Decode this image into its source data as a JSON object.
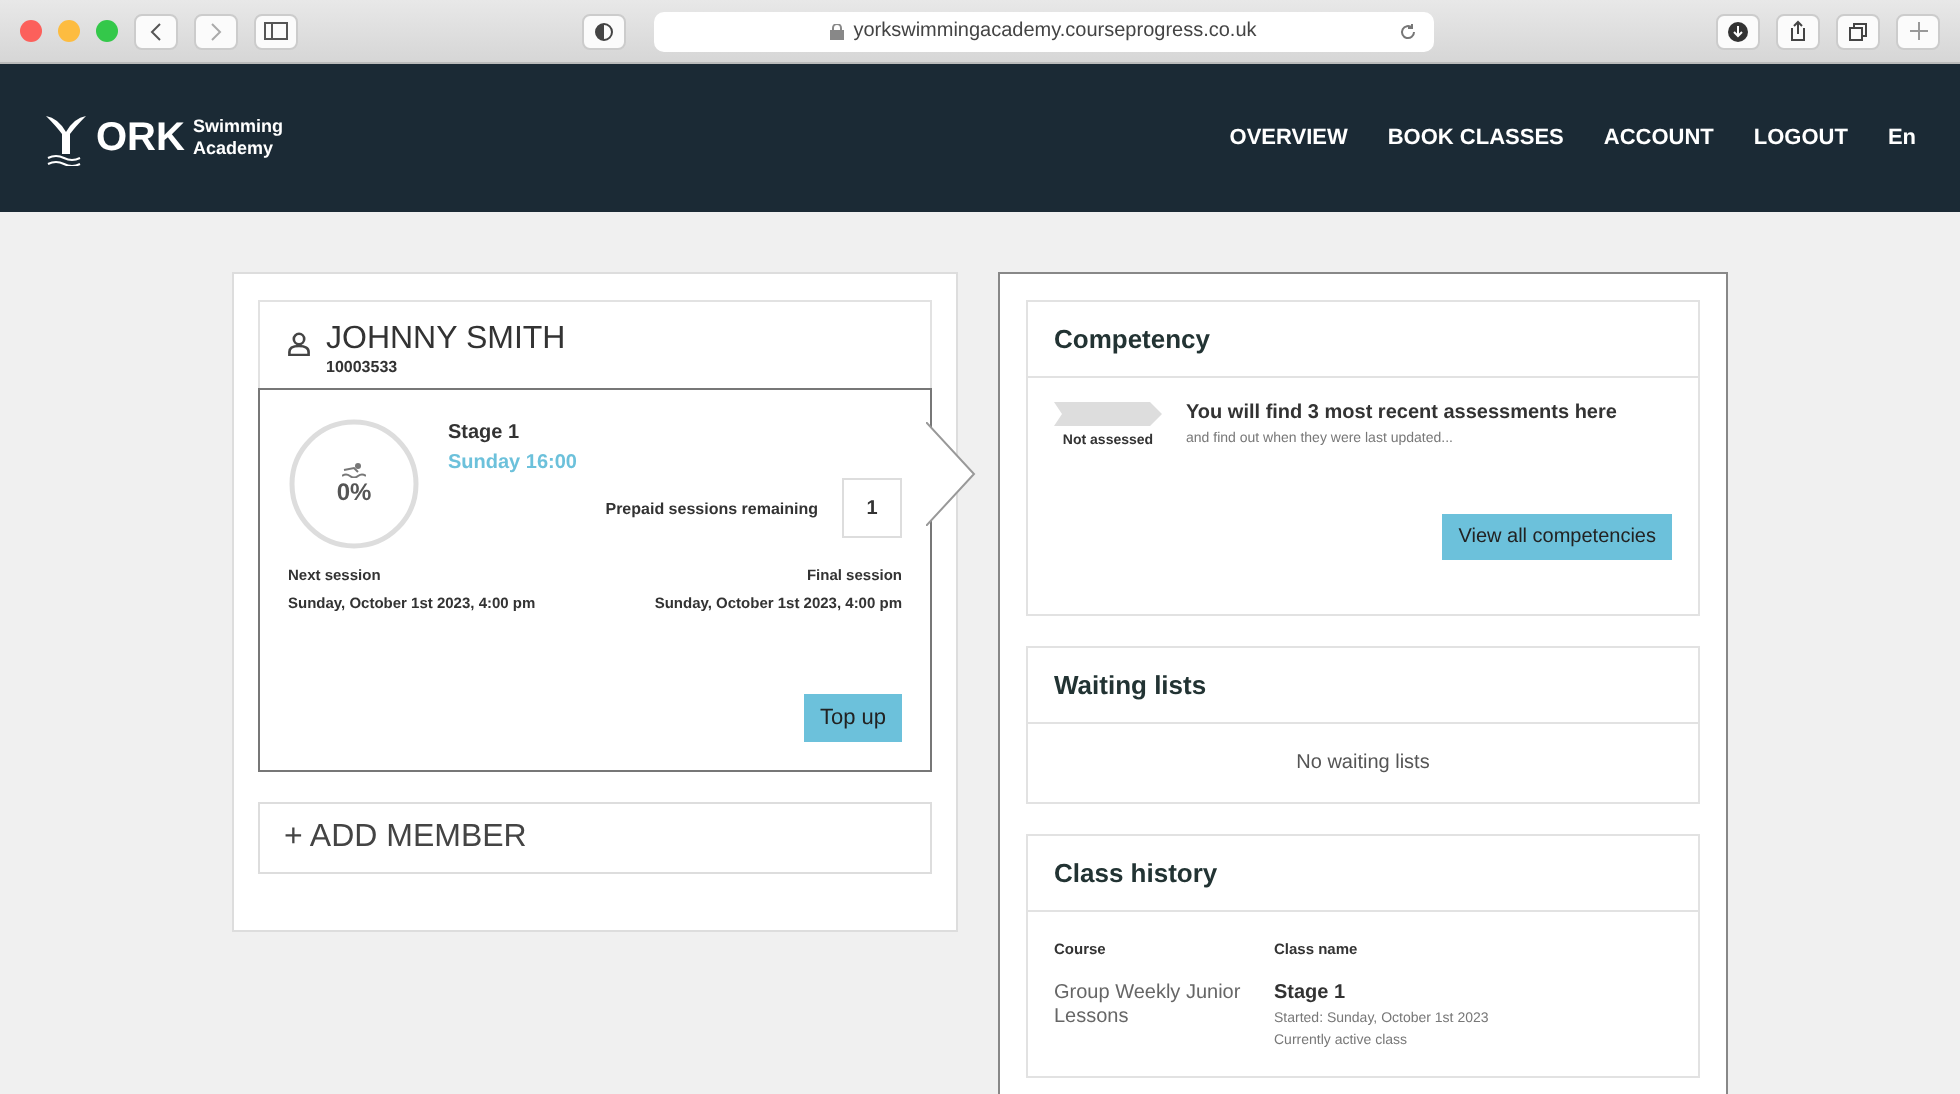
{
  "browser": {
    "url": "yorkswimmingacademy.courseprogress.co.uk"
  },
  "header": {
    "logo_mark": "ORK",
    "logo_line1": "Swimming",
    "logo_line2": "Academy",
    "nav": [
      {
        "label": "OVERVIEW"
      },
      {
        "label": "BOOK CLASSES"
      },
      {
        "label": "ACCOUNT"
      },
      {
        "label": "LOGOUT"
      },
      {
        "label": "En"
      }
    ]
  },
  "member": {
    "name": "JOHNNY SMITH",
    "number": "10003533",
    "progress": {
      "reading": "0%"
    },
    "stage": "Stage 1",
    "time": "Sunday 16:00",
    "prepaid_label": "Prepaid sessions remaining",
    "prepaid_value": "1",
    "next_label": "Next session",
    "next_value": "Sunday, October 1st 2023, 4:00 pm",
    "final_label": "Final session",
    "final_value": "Sunday, October 1st 2023, 4:00 pm",
    "button": "Top up"
  },
  "add_member": "+ ADD MEMBER",
  "competency": {
    "title": "Competency",
    "badge": "Not assessed",
    "heading": "You will find 3 most recent assessments here",
    "subtext": "and find out when they were last updated...",
    "button": "View all competencies"
  },
  "waiting_lists": {
    "title": "Waiting lists",
    "empty": "No waiting lists"
  },
  "class_history": {
    "title": "Class history",
    "columns": [
      "Course",
      "Class name"
    ],
    "rows": [
      {
        "course": "Group Weekly Junior Lessons",
        "class_name": "Stage 1",
        "started": "Started: Sunday, October 1st 2023",
        "status": "Currently active class"
      }
    ]
  }
}
